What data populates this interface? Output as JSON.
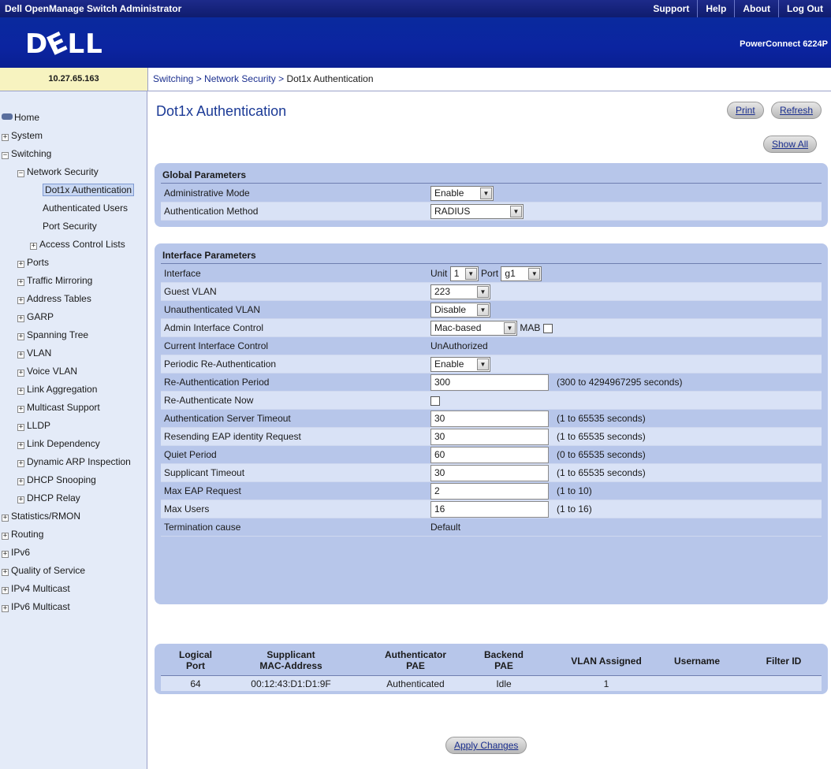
{
  "app": {
    "title": "Dell OpenManage Switch Administrator",
    "links": [
      "Support",
      "Help",
      "About",
      "Log Out"
    ],
    "logo": "DELL",
    "model": "PowerConnect 6224P",
    "ip": "10.27.65.163"
  },
  "breadcrumb": {
    "part1": "Switching",
    "sep": " > ",
    "part2": "Network Security",
    "part3": "Dot1x Authentication"
  },
  "sidebar": {
    "items": [
      {
        "label": "Home"
      },
      {
        "label": "System",
        "pm": "+"
      },
      {
        "label": "Switching",
        "pm": "−"
      },
      {
        "label": "Network Security",
        "pm": "−"
      },
      {
        "label": "Dot1x Authentication"
      },
      {
        "label": "Authenticated Users"
      },
      {
        "label": "Port Security"
      },
      {
        "label": "Access Control Lists",
        "pm": "+"
      },
      {
        "label": "Ports",
        "pm": "+"
      },
      {
        "label": "Traffic Mirroring",
        "pm": "+"
      },
      {
        "label": "Address Tables",
        "pm": "+"
      },
      {
        "label": "GARP",
        "pm": "+"
      },
      {
        "label": "Spanning Tree",
        "pm": "+"
      },
      {
        "label": "VLAN",
        "pm": "+"
      },
      {
        "label": "Voice VLAN",
        "pm": "+"
      },
      {
        "label": "Link Aggregation",
        "pm": "+"
      },
      {
        "label": "Multicast Support",
        "pm": "+"
      },
      {
        "label": "LLDP",
        "pm": "+"
      },
      {
        "label": "Link Dependency",
        "pm": "+"
      },
      {
        "label": "Dynamic ARP Inspection",
        "pm": "+"
      },
      {
        "label": "DHCP Snooping",
        "pm": "+"
      },
      {
        "label": "DHCP Relay",
        "pm": "+"
      },
      {
        "label": "Statistics/RMON",
        "pm": "+"
      },
      {
        "label": "Routing",
        "pm": "+"
      },
      {
        "label": "IPv6",
        "pm": "+"
      },
      {
        "label": "Quality of Service",
        "pm": "+"
      },
      {
        "label": "IPv4 Multicast",
        "pm": "+"
      },
      {
        "label": "IPv6 Multicast",
        "pm": "+"
      }
    ]
  },
  "page": {
    "title": "Dot1x Authentication",
    "print": "Print",
    "refresh": "Refresh",
    "show_all": "Show All",
    "apply": "Apply Changes"
  },
  "global": {
    "title": "Global Parameters",
    "admin_mode_label": "Administrative Mode",
    "admin_mode_value": "Enable",
    "auth_method_label": "Authentication Method",
    "auth_method_value": "RADIUS"
  },
  "iface": {
    "title": "Interface Parameters",
    "interface_label": "Interface",
    "unit_label": "Unit",
    "unit_value": "1",
    "port_label": "Port",
    "port_value": "g1",
    "guest_vlan_label": "Guest VLAN",
    "guest_vlan_value": "223",
    "unauth_vlan_label": "Unauthenticated VLAN",
    "unauth_vlan_value": "Disable",
    "admin_ctrl_label": "Admin Interface Control",
    "admin_ctrl_value": "Mac-based",
    "mab_label": "MAB",
    "current_ctrl_label": "Current Interface Control",
    "current_ctrl_value": "UnAuthorized",
    "periodic_label": "Periodic Re-Authentication",
    "periodic_value": "Enable",
    "reauth_period_label": "Re-Authentication Period",
    "reauth_period_value": "300",
    "reauth_period_hint": "(300 to 4294967295 seconds)",
    "reauth_now_label": "Re-Authenticate Now",
    "server_timeout_label": "Authentication Server Timeout",
    "server_timeout_value": "30",
    "server_timeout_hint": "(1 to 65535 seconds)",
    "resend_label": "Resending EAP identity Request",
    "resend_value": "30",
    "resend_hint": "(1 to 65535 seconds)",
    "quiet_label": "Quiet Period",
    "quiet_value": "60",
    "quiet_hint": "(0 to 65535 seconds)",
    "supp_timeout_label": "Supplicant Timeout",
    "supp_timeout_value": "30",
    "supp_timeout_hint": "(1 to 65535 seconds)",
    "max_eap_label": "Max EAP Request",
    "max_eap_value": "2",
    "max_eap_hint": "(1 to 10)",
    "max_users_label": "Max Users",
    "max_users_value": "16",
    "max_users_hint": "(1 to 16)",
    "term_label": "Termination cause",
    "term_value": "Default"
  },
  "table": {
    "headers": {
      "logical_port": "Logical\nPort",
      "mac": "Supplicant\nMAC-Address",
      "auth_pae": "Authenticator\nPAE",
      "backend_pae": "Backend\nPAE",
      "vlan_assigned": "VLAN Assigned",
      "username": "Username",
      "filter_id": "Filter ID"
    },
    "rows": [
      {
        "logical_port": "64",
        "mac": "00:12:43:D1:D1:9F",
        "auth_pae": "Authenticated",
        "backend_pae": "Idle",
        "vlan_assigned": "1",
        "username": "",
        "filter_id": ""
      }
    ]
  }
}
